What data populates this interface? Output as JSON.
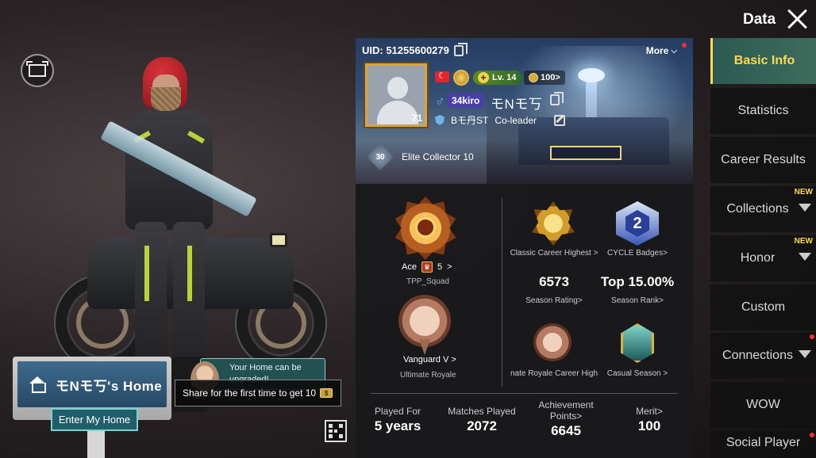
{
  "header": {
    "title": "Data"
  },
  "home": {
    "sign_title": "モNモ丂's Home",
    "enter_label": "Enter My Home",
    "tip_text": "Your Home can be upgraded!",
    "share_text": "Share for the first time to get 10"
  },
  "profile": {
    "uid": "UID: 51255600279",
    "more_label": "More",
    "portrait_level": "71",
    "level": "Lv. 14",
    "coins": "100>",
    "clan_tag": "34kiro",
    "name": "モNモ丂",
    "clan_name": "Bモ丹ST",
    "clan_role": "Co-leader",
    "title_level": "30",
    "title": "Elite Collector 10"
  },
  "stats": {
    "tpp_rank": "Ace",
    "tpp_rank_num": "5",
    "tpp_mode": "TPP_Squad",
    "ultimate_rank": "Vanguard V",
    "ultimate_mode": "Ultimate Royale",
    "classic_highest": "Classic Career Highest >",
    "cycle_badges": "CYCLE Badges>",
    "cycle_number": "2",
    "season_rating": "6573",
    "season_rating_label": "Season Rating>",
    "season_rank": "Top 15.00%",
    "season_rank_label": "Season Rank>",
    "ultimate_career": "nate Royale Career High",
    "casual_season": "Casual Season >",
    "played_for_label": "Played For",
    "played_for": "5 years",
    "matches_label": "Matches Played",
    "matches": "2072",
    "achievement_label_1": "Achievement",
    "achievement_label_2": "Points>",
    "achievement": "6645",
    "merit_label": "Merit>",
    "merit": "100"
  },
  "tabs": [
    {
      "label": "Basic Info"
    },
    {
      "label": "Statistics"
    },
    {
      "label": "Career Results"
    },
    {
      "label": "Collections",
      "badge": "NEW"
    },
    {
      "label": "Honor",
      "badge": "NEW"
    },
    {
      "label": "Custom"
    },
    {
      "label": "Connections"
    },
    {
      "label": "WOW"
    },
    {
      "label": "Social Player"
    }
  ],
  "colors": {
    "active_tab_text": "#ffd94a",
    "active_tab_bg": "#2b5a52",
    "panel_bg": "#19191b"
  },
  "icons": [
    "fit-screen-icon",
    "close-icon",
    "home-icon",
    "copy-icon",
    "edit-icon",
    "qr-code-icon",
    "chevron-down-icon",
    "coin-icon"
  ]
}
